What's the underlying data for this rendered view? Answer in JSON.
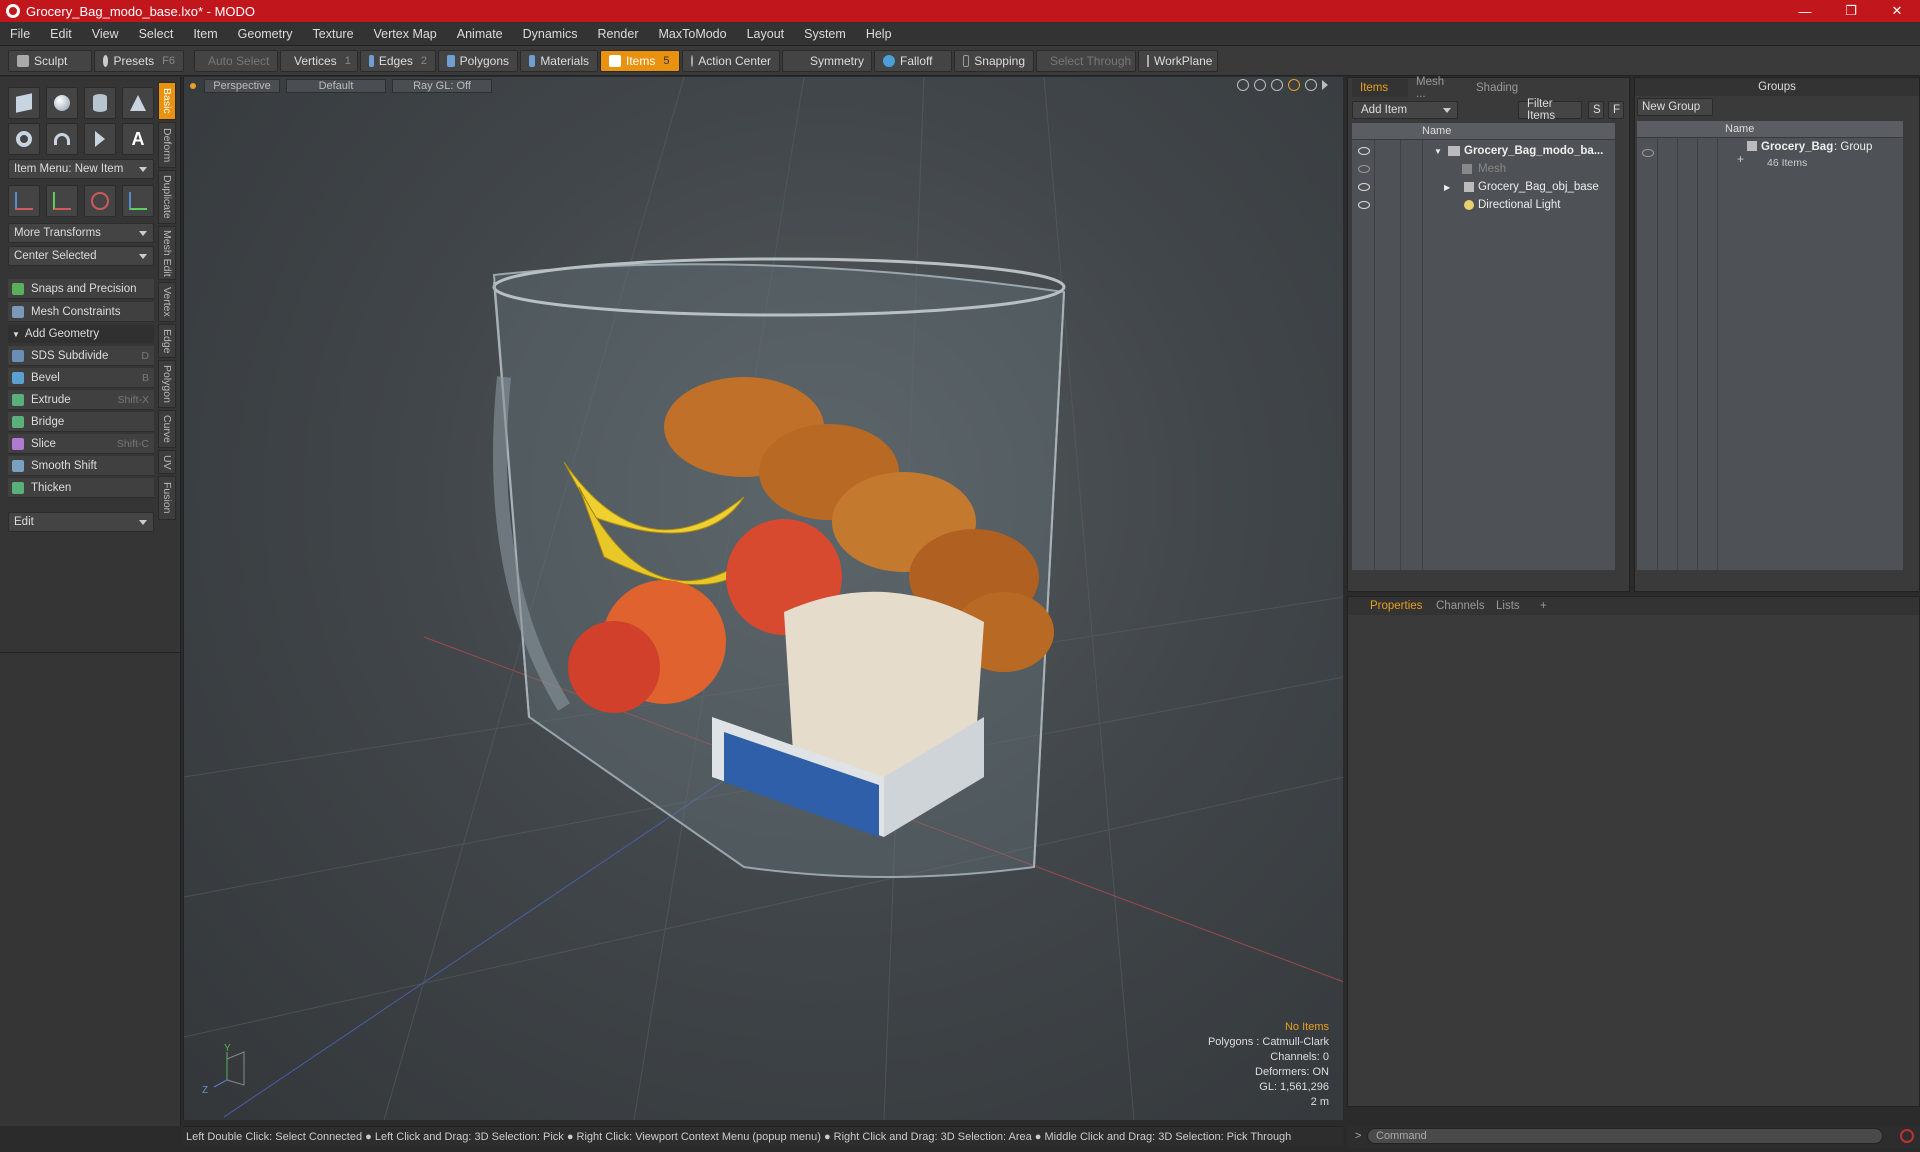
{
  "window": {
    "title": "Grocery_Bag_modo_base.lxo* - MODO",
    "minimize": "—",
    "maximize": "❐",
    "close": "✕"
  },
  "menu": [
    "File",
    "Edit",
    "View",
    "Select",
    "Item",
    "Geometry",
    "Texture",
    "Vertex Map",
    "Animate",
    "Dynamics",
    "Render",
    "MaxToModo",
    "Layout",
    "System",
    "Help"
  ],
  "toolbar": {
    "sculpt": "Sculpt",
    "presets": "Presets",
    "presets_key": "F6",
    "auto_select": "Auto Select",
    "vertices": "Vertices",
    "vertices_count": "1",
    "edges": "Edges",
    "edges_count": "2",
    "polygons": "Polygons",
    "materials": "Materials",
    "items": "Items",
    "items_count": "5",
    "action_center": "Action Center",
    "symmetry": "Symmetry",
    "falloff": "Falloff",
    "snapping": "Snapping",
    "select_through": "Select Through",
    "workplane": "WorkPlane"
  },
  "left": {
    "vtabs": [
      "Basic",
      "Deform",
      "Duplicate",
      "Mesh Edit",
      "Vertex",
      "Edge",
      "Polygon",
      "Curve",
      "UV",
      "Fusion"
    ],
    "item_menu": "Item Menu: New Item",
    "more_transforms": "More Transforms",
    "center_selected": "Center Selected",
    "snaps": "Snaps and Precision",
    "mesh_constraints": "Mesh Constraints",
    "add_geometry": "Add Geometry",
    "tools": [
      {
        "label": "SDS Subdivide",
        "key": "D"
      },
      {
        "label": "Bevel",
        "key": "B"
      },
      {
        "label": "Extrude",
        "key": "Shift-X"
      },
      {
        "label": "Bridge",
        "key": ""
      },
      {
        "label": "Slice",
        "key": "Shift-C"
      },
      {
        "label": "Smooth Shift",
        "key": ""
      },
      {
        "label": "Thicken",
        "key": ""
      }
    ],
    "edit": "Edit"
  },
  "viewport": {
    "perspective": "Perspective",
    "default": "Default",
    "raygl": "Ray GL: Off",
    "info": {
      "no_items": "No Items",
      "polygons": "Polygons : Catmull-Clark",
      "channels": "Channels: 0",
      "deformers": "Deformers: ON",
      "gl": "GL: 1,561,296",
      "scale": "2 m"
    },
    "axis_y": "Y",
    "axis_z": "Z"
  },
  "status": "Left Double Click: Select Connected ● Left Click and Drag: 3D Selection: Pick ● Right Click: Viewport Context Menu (popup menu) ● Right Click and Drag: 3D Selection: Area ● Middle Click and Drag: 3D Selection: Pick Through",
  "items_panel": {
    "tabs": [
      "Items",
      "Mesh ...",
      "Shading"
    ],
    "add_item": "Add Item",
    "filter_items": "Filter Items",
    "s": "S",
    "f": "F",
    "col_name": "Name",
    "rows": [
      {
        "label": "Grocery_Bag_modo_ba..."
      },
      {
        "label": "Mesh"
      },
      {
        "label": "Grocery_Bag_obj_base"
      },
      {
        "label": "Directional Light"
      }
    ]
  },
  "groups_panel": {
    "title": "Groups",
    "new_group": "New Group",
    "col_name": "Name",
    "group_name": "Grocery_Bag",
    "group_type": ": Group",
    "group_count": "46 Items"
  },
  "props_panel": {
    "tabs": [
      "Properties",
      "Channels",
      "Lists"
    ],
    "plus": "+"
  },
  "command": {
    "placeholder": "Command",
    "prompt": ">"
  }
}
